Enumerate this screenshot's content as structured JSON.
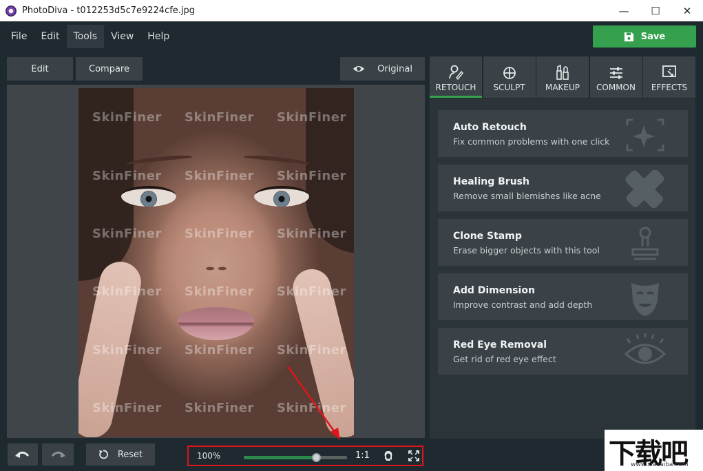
{
  "window": {
    "title": "PhotoDiva - t012253d5c7e9224cfe.jpg",
    "minimize_glyph": "—",
    "maximize_glyph": "☐",
    "close_glyph": "✕"
  },
  "menu": {
    "items": [
      "File",
      "Edit",
      "Tools",
      "View",
      "Help"
    ],
    "active": "Tools"
  },
  "toolbar": {
    "save_label": "Save",
    "edit_label": "Edit",
    "compare_label": "Compare",
    "original_label": "Original"
  },
  "photo": {
    "watermark_text": "SkinFiner"
  },
  "bottom_bar": {
    "undo_icon": "undo-icon",
    "redo_icon": "redo-icon",
    "reset_label": "Reset",
    "zoom_percent_label": "100%",
    "zoom_slider_fraction": 0.7,
    "ratio_label": "1:1",
    "face_icon": "face-icon",
    "fullscreen_icon": "fullscreen-icon"
  },
  "tabs": [
    {
      "label": "RETOUCH",
      "icon": "retouch-icon",
      "active": true
    },
    {
      "label": "SCULPT",
      "icon": "sculpt-icon",
      "active": false
    },
    {
      "label": "MAKEUP",
      "icon": "makeup-icon",
      "active": false
    },
    {
      "label": "COMMON",
      "icon": "sliders-icon",
      "active": false
    },
    {
      "label": "EFFECTS",
      "icon": "effects-icon",
      "active": false
    }
  ],
  "tools": [
    {
      "title": "Auto Retouch",
      "description": "Fix common problems with one click",
      "icon": "auto-retouch-icon"
    },
    {
      "title": "Healing Brush",
      "description": "Remove small blemishes like acne",
      "icon": "bandage-icon"
    },
    {
      "title": "Clone Stamp",
      "description": "Erase bigger objects with this tool",
      "icon": "stamp-icon"
    },
    {
      "title": "Add Dimension",
      "description": "Improve contrast and add depth",
      "icon": "mask-icon"
    },
    {
      "title": "Red Eye Removal",
      "description": "Get rid of red eye effect",
      "icon": "eye-icon"
    }
  ],
  "corner_logo": {
    "big_text": "下载吧",
    "small_text": "www.xiazaiba.com"
  },
  "colors": {
    "accent_green": "#35a14e",
    "highlight_red": "#e0141b",
    "background": "#1f2a30"
  }
}
